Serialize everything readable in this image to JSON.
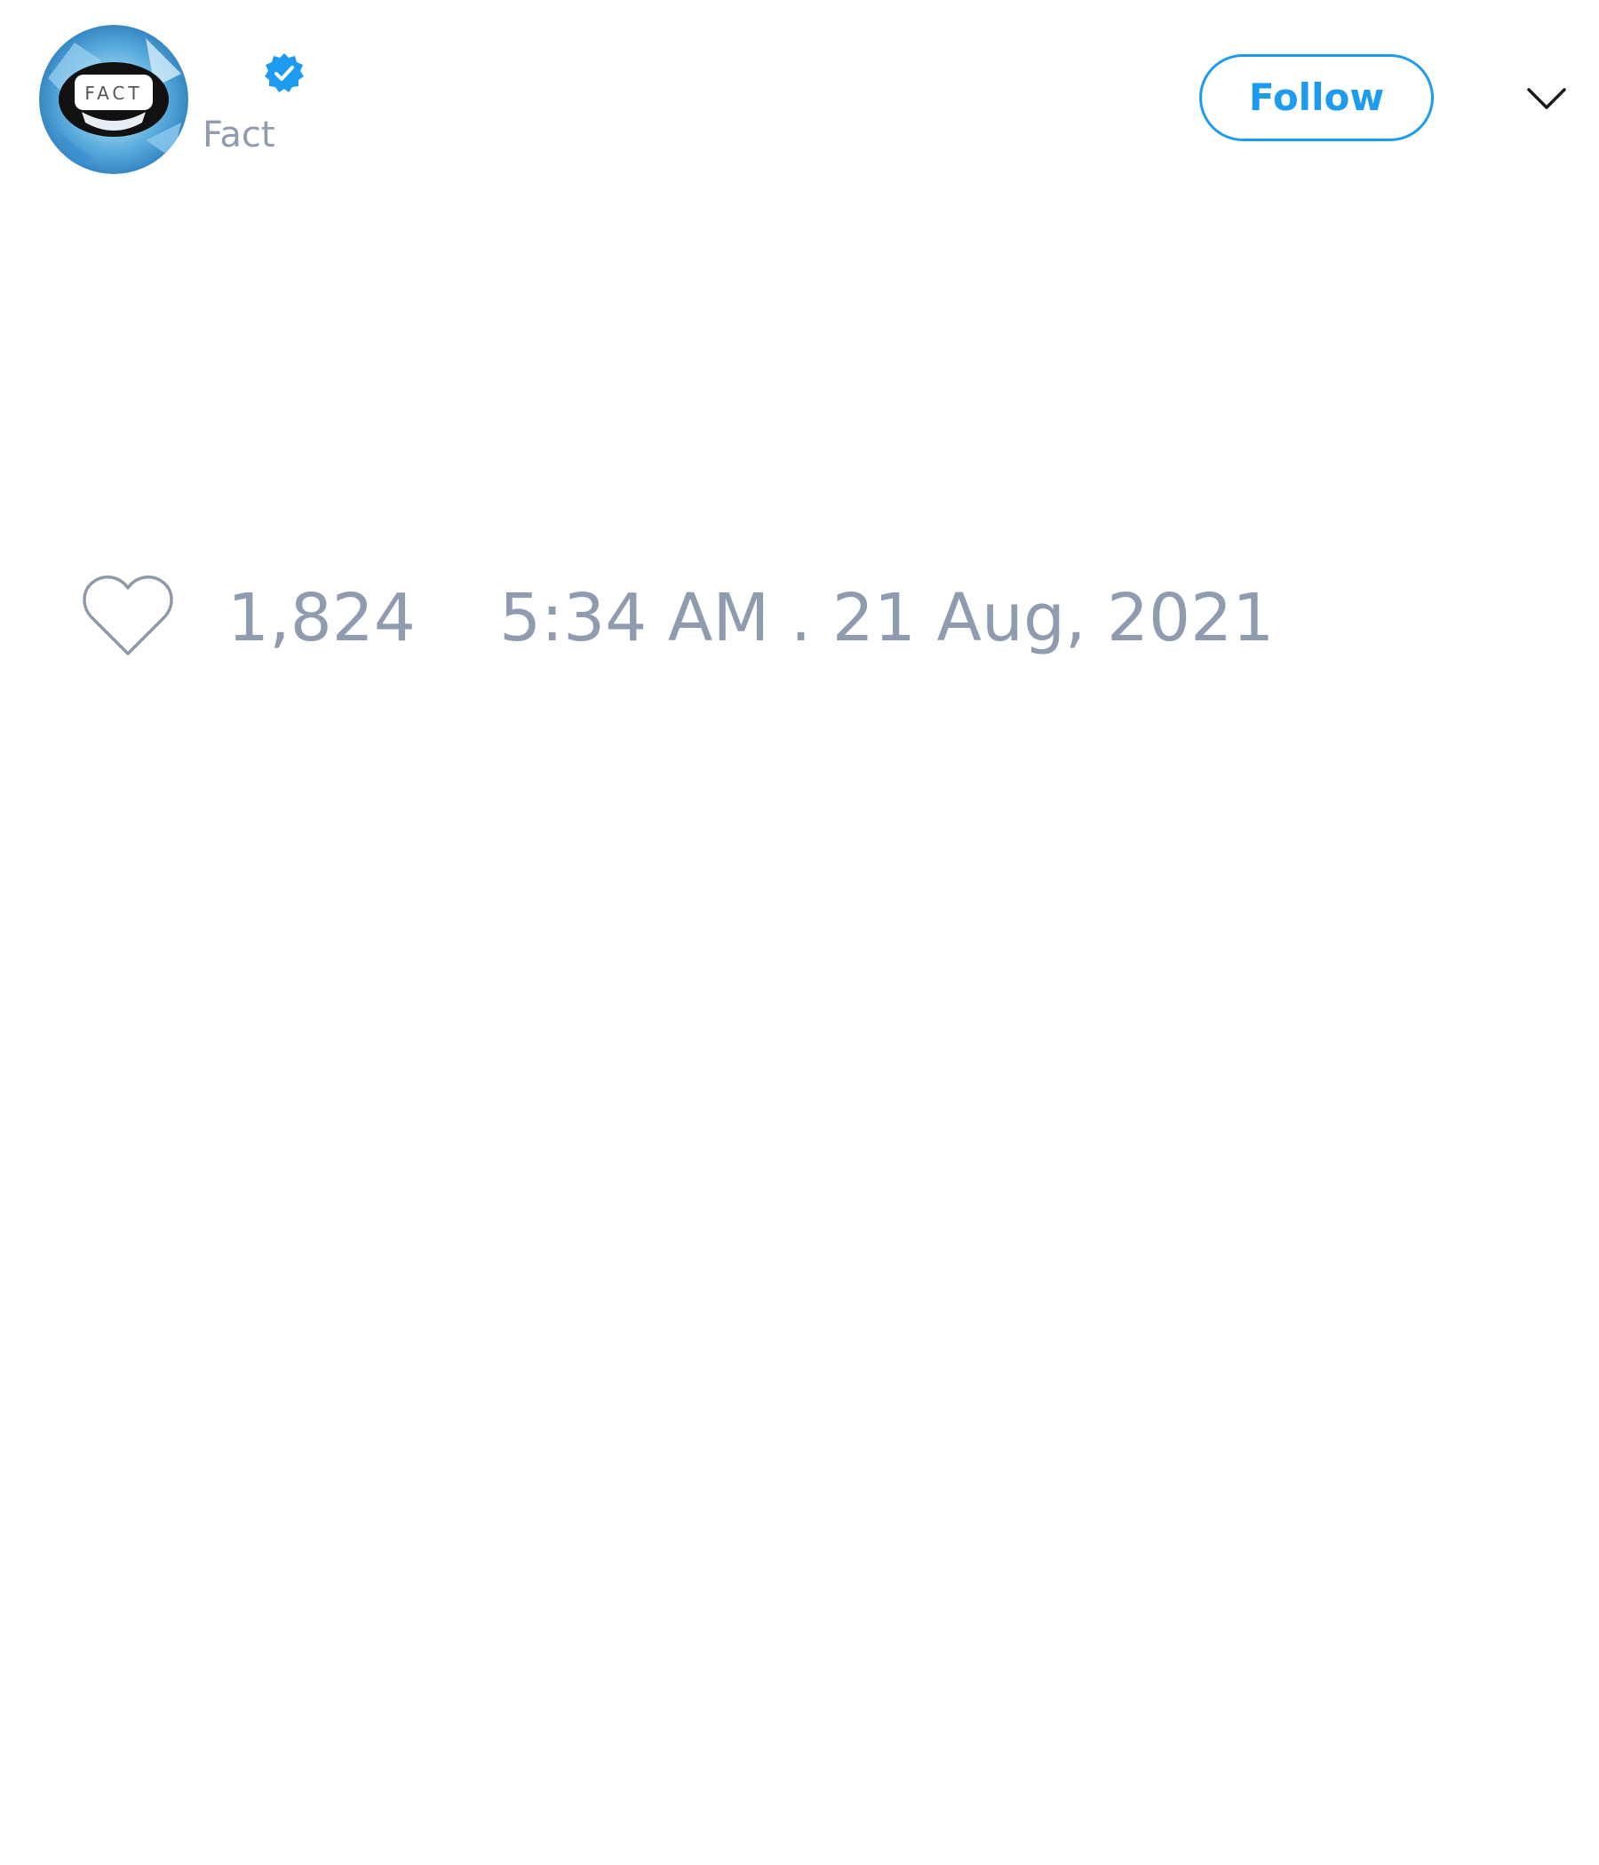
{
  "colors": {
    "accent": "#1d9bf0",
    "muted_text": "#8f9cb0",
    "icon_dark": "#1a1a1a",
    "heart_stroke": "#8f9aa8"
  },
  "author": {
    "avatar_icon": "fact-logo-avatar",
    "avatar_logo_text": "FACT",
    "verified_icon": "verified-badge-icon",
    "handle": "Fact"
  },
  "actions": {
    "follow_label": "Follow",
    "more_icon": "chevron-down-icon"
  },
  "tweet": {
    "like_icon": "heart-outline-icon",
    "like_count": "1,824",
    "timestamp": "5:34 AM . 21 Aug, 2021"
  }
}
